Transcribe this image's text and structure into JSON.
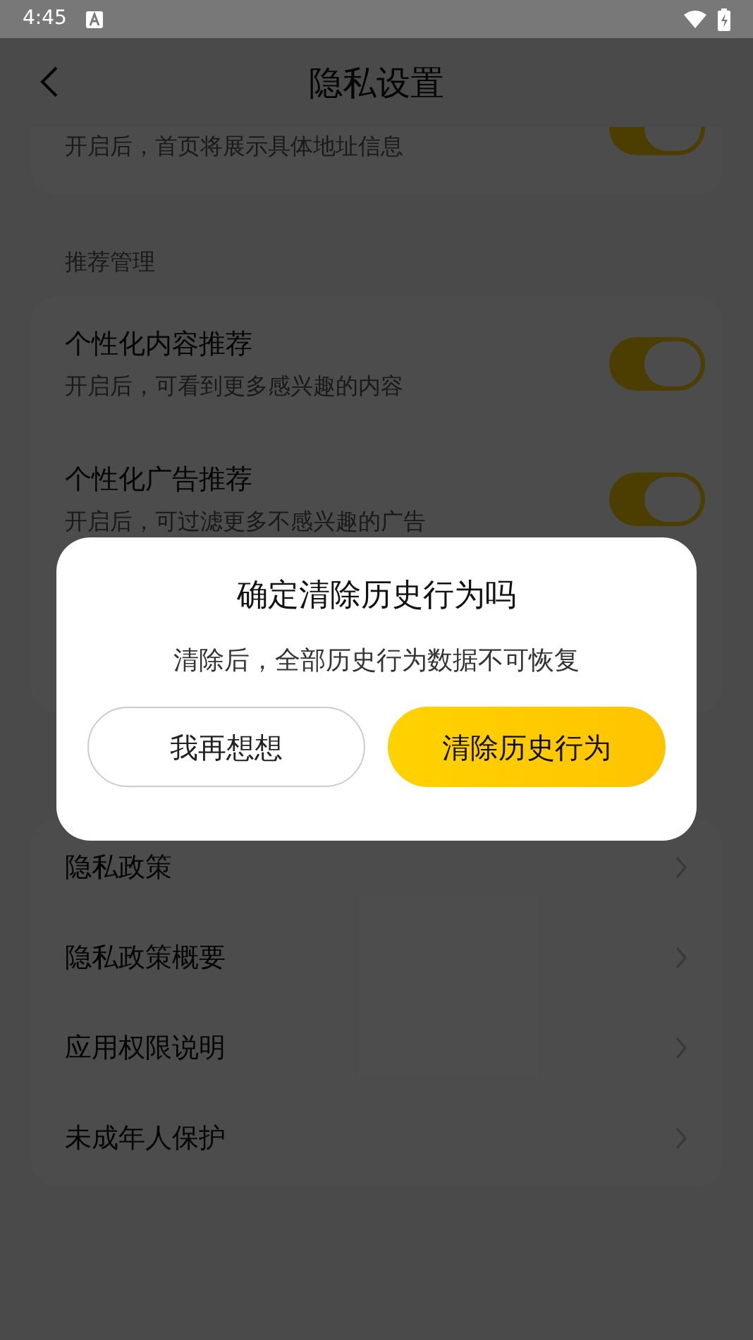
{
  "status_bar": {
    "time": "4:45"
  },
  "header": {
    "title": "隐私设置"
  },
  "sections": [
    {
      "items": [
        {
          "kind": "toggle",
          "subtitle": "开启后，首页将展示具体地址信息",
          "on": true
        }
      ]
    },
    {
      "label": "推荐管理",
      "items": [
        {
          "kind": "toggle",
          "title": "个性化内容推荐",
          "subtitle": "开启后，可看到更多感兴趣的内容",
          "on": true
        },
        {
          "kind": "toggle",
          "title": "个性化广告推荐",
          "subtitle": "开启后，可过滤更多不感兴趣的广告",
          "on": true
        }
      ]
    },
    {
      "items": [
        {
          "kind": "link",
          "title": "隐私政策"
        },
        {
          "kind": "link",
          "title": "隐私政策概要"
        },
        {
          "kind": "link",
          "title": "应用权限说明"
        },
        {
          "kind": "link",
          "title": "未成年人保护"
        }
      ]
    }
  ],
  "dialog": {
    "title": "确定清除历史行为吗",
    "message": "清除后，全部历史行为数据不可恢复",
    "buttons": [
      {
        "kind": "secondary",
        "label": "我再想想"
      },
      {
        "kind": "primary",
        "label": "清除历史行为"
      }
    ]
  }
}
